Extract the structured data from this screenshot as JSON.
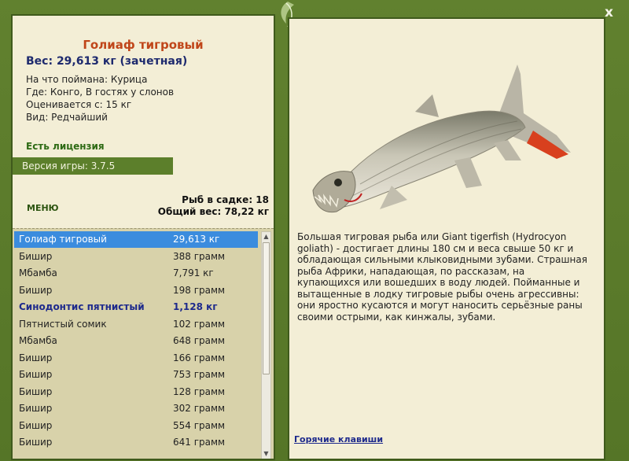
{
  "close_label": "x",
  "fish": {
    "name": "Голиаф тигровый",
    "weight": "Вес: 29,613 кг (зачетная)",
    "caught_on": "На что поймана: Курица",
    "location": "Где: Конго, В гостях у слонов",
    "valued_from": "Оценивается с: 15 кг",
    "kind": "Вид: Редчайший"
  },
  "license": "Есть лицензия",
  "version": "Версия игры: 3.7.5",
  "menu_label": "МЕНЮ",
  "stats": {
    "fish_count": "Рыб в садке: 18",
    "total_weight": "Общий вес: 78,22 кг"
  },
  "catch_list": [
    {
      "name": "Голиаф тигровый",
      "weight": "29,613 кг"
    },
    {
      "name": "Бишир",
      "weight": "388 грамм"
    },
    {
      "name": "Мбамба",
      "weight": "7,791 кг"
    },
    {
      "name": "Бишир",
      "weight": "198 грамм"
    },
    {
      "name": "Синодонтис пятнистый",
      "weight": "1,128 кг"
    },
    {
      "name": "Пятнистый сомик",
      "weight": "102 грамм"
    },
    {
      "name": "Мбамба",
      "weight": "648 грамм"
    },
    {
      "name": "Бишир",
      "weight": "166 грамм"
    },
    {
      "name": "Бишир",
      "weight": "753 грамм"
    },
    {
      "name": "Бишир",
      "weight": "128 грамм"
    },
    {
      "name": "Бишир",
      "weight": "302 грамм"
    },
    {
      "name": "Бишир",
      "weight": "554 грамм"
    },
    {
      "name": "Бишир",
      "weight": "641 грамм"
    }
  ],
  "description": "Большая тигровая рыба или Giant tigerfish (Hydrocyon goliath) - достигает длины 180 см и веса свыше 50 кг и обладающая сильными клыковидными зубами. Страшная рыба Африки, нападающая, по рассказам, на купающихся или вошедших в воду людей. Пойманные и вытащенные в лодку тигровые рыбы очень агрессивны: они яростно кусаются и могут наносить серьёзные раны своими острыми, как кинжалы, зубами.",
  "hotkeys_label": "Горячие клавиши",
  "colors": {
    "frame": "#5a7a2e",
    "panel": "#f3eed6",
    "title": "#c0461a",
    "selected_row": "#3b8cde",
    "rare_text": "#1e2a8c"
  }
}
